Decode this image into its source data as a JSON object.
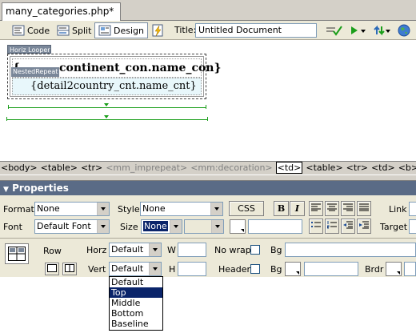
{
  "tab": {
    "filename": "many_categories.php*"
  },
  "toolbar": {
    "code_label": "Code",
    "split_label": "Split",
    "design_label": "Design",
    "title_label": "Title:",
    "title_value": "Untitled Document"
  },
  "design": {
    "looper_label": "Horiz Looper",
    "nested_label": "NestedRepeat",
    "open_brace": "{",
    "continent_binding": "continent_con.name_con}",
    "detail_binding": "{detail2country_cnt.name_cnt}"
  },
  "tag_selector": [
    {
      "text": "<body>",
      "state": "normal"
    },
    {
      "text": "<table>",
      "state": "normal"
    },
    {
      "text": "<tr>",
      "state": "normal"
    },
    {
      "text": "<mm_imprepeat>",
      "state": "dim"
    },
    {
      "text": "<mm:decoration>",
      "state": "dim"
    },
    {
      "text": "<td>",
      "state": "selected"
    },
    {
      "text": "<table>",
      "state": "normal"
    },
    {
      "text": "<tr>",
      "state": "normal"
    },
    {
      "text": "<td>",
      "state": "normal"
    },
    {
      "text": "<b>",
      "state": "normal"
    }
  ],
  "properties": {
    "header": "Properties",
    "format_label": "Format",
    "format_value": "None",
    "style_label": "Style",
    "style_value": "None",
    "css_label": "CSS",
    "bold_label": "B",
    "italic_label": "I",
    "link_label": "Link",
    "font_label": "Font",
    "font_value": "Default Font",
    "size_label": "Size",
    "size_value": "None",
    "target_label": "Target",
    "row_label": "Row",
    "horz_label": "Horz",
    "horz_value": "Default",
    "w_label": "W",
    "nowrap_label": "No wrap",
    "bg_label": "Bg",
    "vert_label": "Vert",
    "vert_value": "Default",
    "h_label": "H",
    "header_label": "Header",
    "bg2_label": "Bg",
    "brdr_label": "Brdr"
  },
  "vert_dropdown": {
    "options": [
      "Default",
      "Top",
      "Middle",
      "Bottom",
      "Baseline"
    ],
    "highlighted": "Top"
  },
  "colors": {
    "panel_header": "#5a6b86",
    "selection": "#0a246a",
    "guide_green": "#1a9e1a",
    "detail_cell_bg": "#e8f7fb"
  },
  "icons": [
    "code-view-icon",
    "split-view-icon",
    "design-view-icon",
    "lightning-icon",
    "validate-icon",
    "preview-icon",
    "refresh-icon",
    "globe-icon",
    "align-left-icon",
    "align-center-icon",
    "align-right-icon",
    "justify-icon",
    "unordered-list-icon",
    "ordered-list-icon",
    "outdent-icon",
    "indent-icon",
    "cell-icon",
    "merge-cells-icon",
    "split-cell-icon"
  ]
}
